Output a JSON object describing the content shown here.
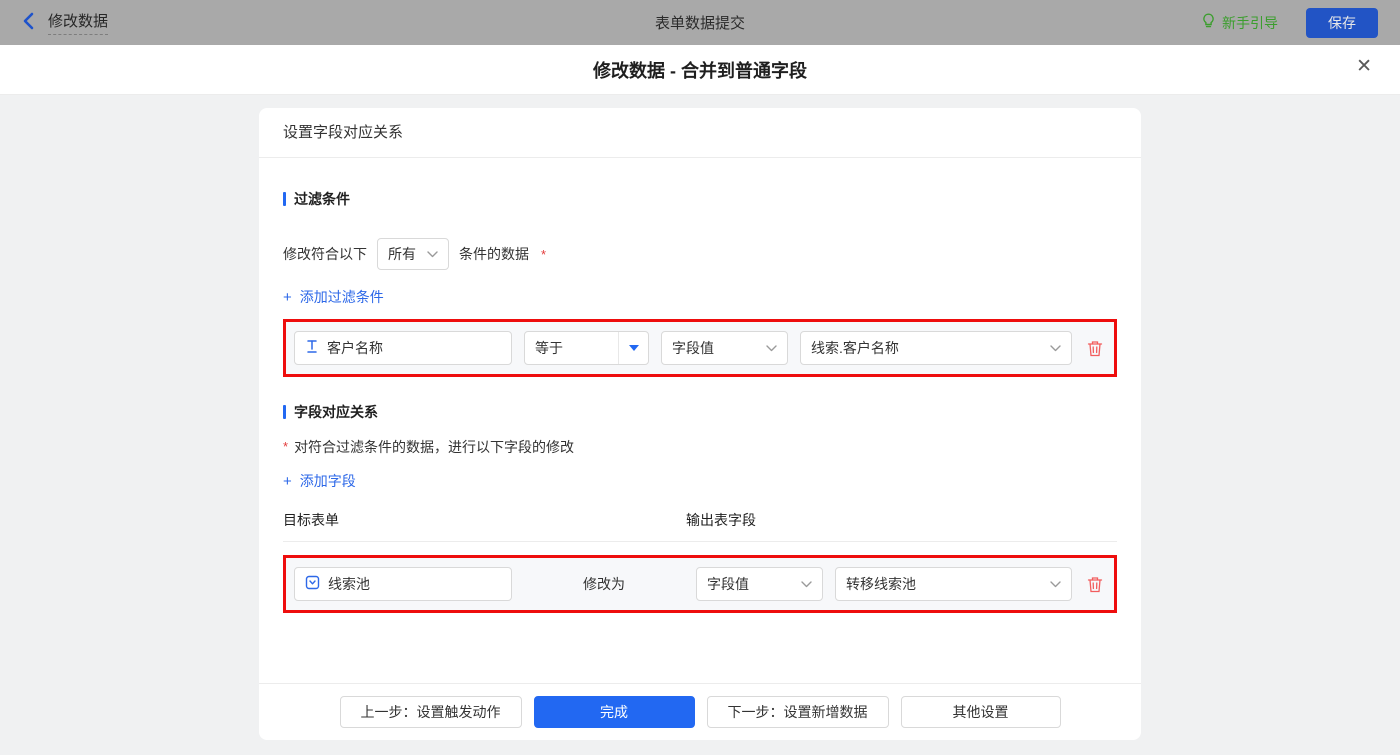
{
  "topbar": {
    "back_label": "修改数据",
    "title": "表单数据提交",
    "guide_label": "新手引导",
    "save_label": "保存"
  },
  "modal": {
    "title": "修改数据 - 合并到普通字段",
    "close_glyph": "✕"
  },
  "card": {
    "header": "设置字段对应关系",
    "filter_section": {
      "title": "过滤条件",
      "match_prefix": "修改符合以下",
      "match_select_value": "所有",
      "match_suffix": "条件的数据",
      "required_mark": "*",
      "add_plus": "+",
      "add_label": "添加过滤条件",
      "condition_row": {
        "field": "客户名称",
        "operator": "等于",
        "value_type": "字段值",
        "value_source": "线索.客户名称"
      }
    },
    "mapping_section": {
      "title": "字段对应关系",
      "required_mark": "*",
      "description": "对符合过滤条件的数据，进行以下字段的修改",
      "add_plus": "+",
      "add_label": "添加字段",
      "columns": {
        "target": "目标表单",
        "output": "输出表字段"
      },
      "mapping_row": {
        "target_field": "线索池",
        "action_label": "修改为",
        "value_type": "字段值",
        "output_field": "转移线索池"
      }
    },
    "footer": {
      "prev_label": "上一步：设置触发动作",
      "done_label": "完成",
      "next_label": "下一步：设置新增数据",
      "other_label": "其他设置"
    }
  },
  "colors": {
    "accent_blue": "#2268f2",
    "link_blue": "#2d68e8",
    "highlight_red": "#ee0d0d",
    "danger_red": "#f25d5d",
    "guide_green": "#3b9e2d",
    "topbar_dimmed": "#a9a9a9"
  }
}
